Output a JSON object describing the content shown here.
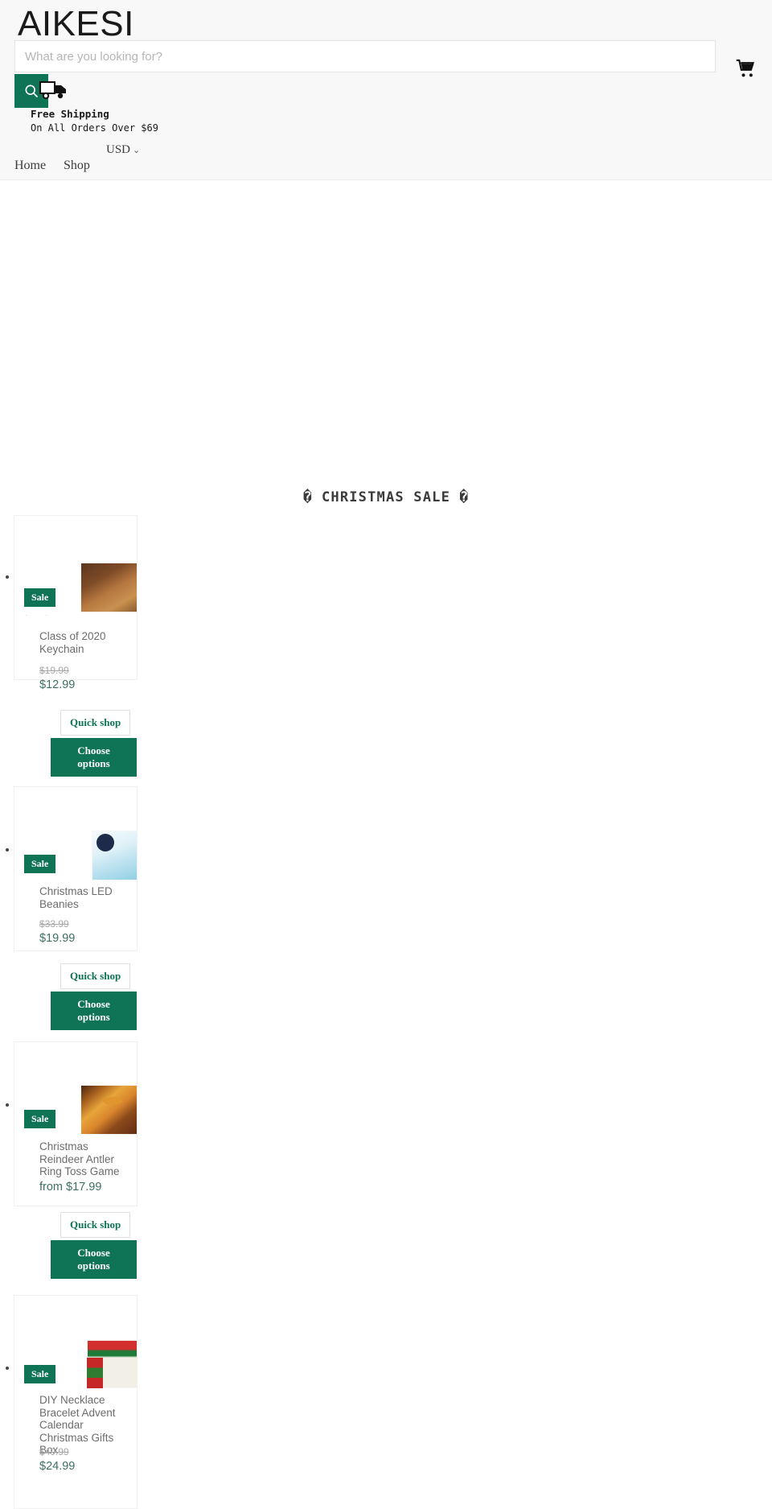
{
  "header": {
    "logo": "AIKESI",
    "search": {
      "placeholder": "What are you looking for?",
      "value": "",
      "button_icon": "search-icon"
    },
    "cart_icon": "shopping-cart-icon",
    "truck_icon": "delivery-truck-icon",
    "shipping": {
      "title": "Free Shipping",
      "subtitle": "On All Orders Over $69"
    },
    "currency": {
      "selected": "USD",
      "chevron": "⌄"
    },
    "nav": [
      {
        "label": "Home",
        "name": "nav-item-home"
      },
      {
        "label": "Shop",
        "name": "nav-item-shop"
      }
    ]
  },
  "collection": {
    "title": "� CHRISTMAS SALE �",
    "products": [
      {
        "title": "Class of 2020 Keychain",
        "badge": "Sale",
        "price_old": "$19.99",
        "price_new": "$12.99",
        "quick_shop": "Quick shop",
        "choose_options": "Choose options",
        "carousel_arrows": "( )",
        "image_alt": "class-of-2020-keychain-image"
      },
      {
        "title": "Christmas LED Beanies",
        "badge": "Sale",
        "price_old": "$33.99",
        "price_new": "$19.99",
        "quick_shop": "Quick shop",
        "choose_options": "Choose options",
        "carousel_arrows": "",
        "image_alt": "christmas-led-beanies-image"
      },
      {
        "title": "Christmas Reindeer Antler Ring Toss Game",
        "badge": "Sale",
        "price_old": "",
        "price_new": "from $17.99",
        "quick_shop": "Quick shop",
        "choose_options": "Choose options",
        "carousel_arrows": "",
        "image_alt": "reindeer-antler-ring-toss-game-image"
      },
      {
        "title": "DIY Necklace Bracelet Advent Calendar Christmas Gifts Box",
        "badge": "Sale",
        "price_old": "$49.99",
        "price_new": "$24.99",
        "quick_shop": "",
        "choose_options": "",
        "carousel_arrows": "",
        "image_alt": "diy-advent-calendar-gift-box-image"
      }
    ]
  },
  "colors": {
    "brand_teal": "#0f7355",
    "header_bg": "#f8f8f8",
    "price_new": "#3d6f63",
    "price_old": "#a8a8a8",
    "title_text": "#6d6d6d"
  }
}
